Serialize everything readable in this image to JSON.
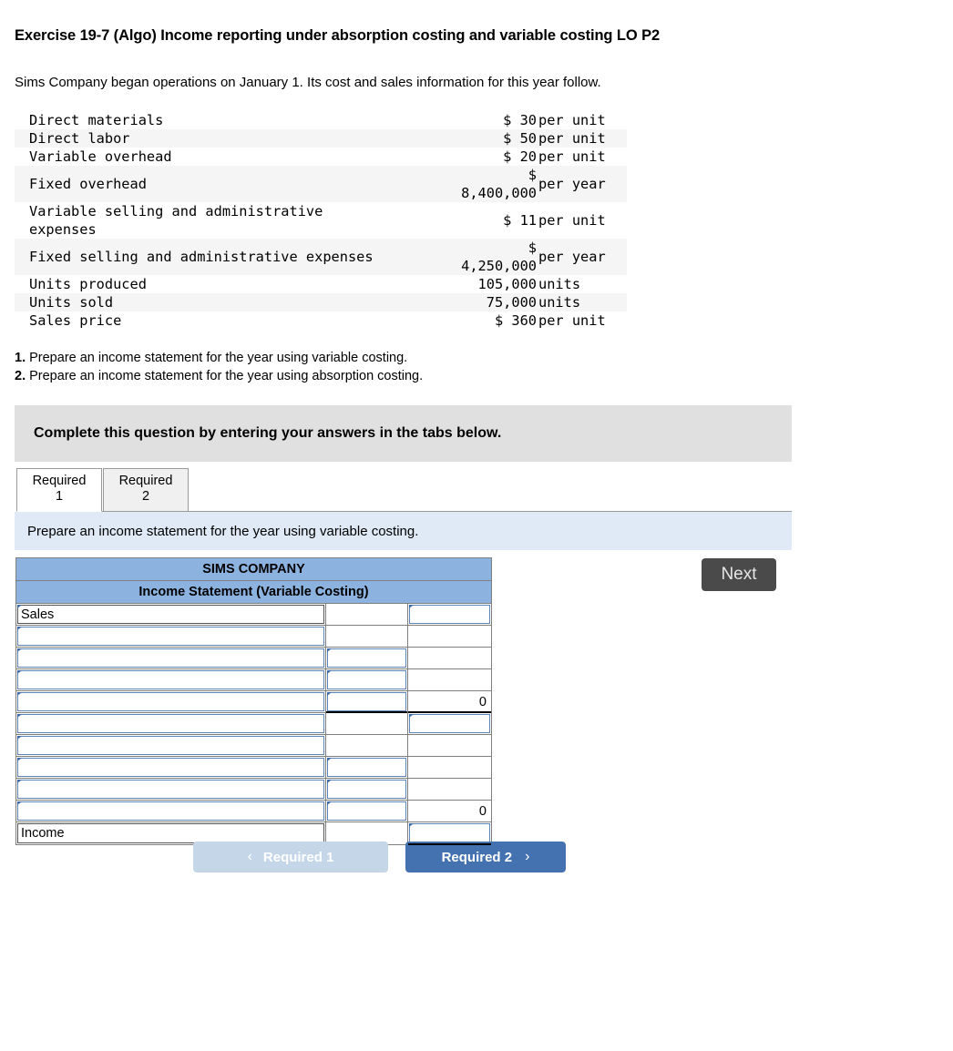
{
  "exercise": {
    "title": "Exercise 19-7 (Algo) Income reporting under absorption costing and variable costing LO P2",
    "intro": "Sims Company began operations on January 1. Its cost and sales information for this year follow."
  },
  "fact_table": {
    "rows": [
      {
        "label": "Direct materials",
        "amount": "$ 30",
        "unit": "per unit",
        "tall": false
      },
      {
        "label": "Direct labor",
        "amount": "$ 50",
        "unit": "per unit",
        "tall": false
      },
      {
        "label": "Variable overhead",
        "amount": "$ 20",
        "unit": "per unit",
        "tall": false
      },
      {
        "label": "Fixed overhead",
        "amount": "$\n8,400,000",
        "unit": "per year",
        "tall": true
      },
      {
        "label": "Variable selling and administrative\nexpenses",
        "amount": "$ 11",
        "unit": "per unit",
        "tall": true
      },
      {
        "label": "Fixed selling and administrative expenses",
        "amount": "$\n4,250,000",
        "unit": "per year",
        "tall": true
      },
      {
        "label": "Units produced",
        "amount": "105,000",
        "unit": "units",
        "tall": false
      },
      {
        "label": "Units sold",
        "amount": "75,000",
        "unit": "units",
        "tall": false
      },
      {
        "label": "Sales price",
        "amount": "$ 360",
        "unit": "per unit",
        "tall": false
      }
    ]
  },
  "requirements": [
    {
      "num": "1.",
      "text": " Prepare an income statement for the year using variable costing."
    },
    {
      "num": "2.",
      "text": " Prepare an income statement for the year using absorption costing."
    }
  ],
  "complete_bar": {
    "text": "Complete this question by entering your answers in the tabs below."
  },
  "tabs": [
    {
      "line1": "Required",
      "line2": "1",
      "active": true
    },
    {
      "line1": "Required",
      "line2": "2",
      "active": false
    }
  ],
  "instruction": {
    "text": "Prepare an income statement for the year using variable costing."
  },
  "worksheet": {
    "title_line1": "SIMS COMPANY",
    "title_line2": "Income Statement (Variable Costing)",
    "rows": [
      {
        "desc": "Sales",
        "desc_border": "dark",
        "desc_marker": true,
        "mid": "",
        "mid_border": "none",
        "mid_marker": false,
        "amt": "",
        "amt_border": "blue",
        "amt_marker": true,
        "amt_rule": false,
        "mid_rule": false
      },
      {
        "desc": "",
        "desc_border": "blue",
        "desc_marker": true,
        "mid": "",
        "mid_border": "none",
        "mid_marker": false,
        "amt": "",
        "amt_border": "none",
        "amt_marker": false,
        "amt_rule": false,
        "mid_rule": false
      },
      {
        "desc": "",
        "desc_border": "blue",
        "desc_marker": true,
        "mid": "",
        "mid_border": "blue",
        "mid_marker": true,
        "amt": "",
        "amt_border": "none",
        "amt_marker": false,
        "amt_rule": false,
        "mid_rule": false
      },
      {
        "desc": "",
        "desc_border": "blue",
        "desc_marker": true,
        "mid": "",
        "mid_border": "blue",
        "mid_marker": true,
        "amt": "",
        "amt_border": "none",
        "amt_marker": false,
        "amt_rule": false,
        "mid_rule": false
      },
      {
        "desc": "",
        "desc_border": "blue",
        "desc_marker": true,
        "mid": "",
        "mid_border": "blue",
        "mid_marker": true,
        "amt": "0",
        "amt_border": "none",
        "amt_marker": false,
        "amt_rule": true,
        "mid_rule": true
      },
      {
        "desc": "",
        "desc_border": "blue",
        "desc_marker": true,
        "mid": "",
        "mid_border": "none",
        "mid_marker": false,
        "amt": "",
        "amt_border": "blue",
        "amt_marker": true,
        "amt_rule": false,
        "mid_rule": false
      },
      {
        "desc": "",
        "desc_border": "blue",
        "desc_marker": true,
        "mid": "",
        "mid_border": "none",
        "mid_marker": false,
        "amt": "",
        "amt_border": "none",
        "amt_marker": false,
        "amt_rule": false,
        "mid_rule": false
      },
      {
        "desc": "",
        "desc_border": "blue",
        "desc_marker": true,
        "mid": "",
        "mid_border": "blue",
        "mid_marker": true,
        "amt": "",
        "amt_border": "none",
        "amt_marker": false,
        "amt_rule": false,
        "mid_rule": false
      },
      {
        "desc": "",
        "desc_border": "blue",
        "desc_marker": true,
        "mid": "",
        "mid_border": "blue",
        "mid_marker": true,
        "amt": "",
        "amt_border": "none",
        "amt_marker": false,
        "amt_rule": false,
        "mid_rule": false
      },
      {
        "desc": "",
        "desc_border": "blue",
        "desc_marker": true,
        "mid": "",
        "mid_border": "blue",
        "mid_marker": true,
        "amt": "0",
        "amt_border": "none",
        "amt_marker": false,
        "amt_rule": false,
        "mid_rule": false
      },
      {
        "desc": "Income",
        "desc_border": "dark",
        "desc_marker": false,
        "mid": "",
        "mid_border": "none",
        "mid_marker": false,
        "amt": "",
        "amt_border": "blue",
        "amt_marker": true,
        "amt_rule": true,
        "mid_rule": false
      }
    ]
  },
  "nav": {
    "prev_label": "Required 1",
    "prev_chevron": "chevron-left-icon",
    "next_label": "Required 2",
    "next_chevron": "chevron-right-icon",
    "prev_glyph": "‹",
    "next_glyph": "›"
  },
  "next_button": {
    "label": "Next"
  },
  "colors": {
    "header_blue": "#8cb2e0",
    "instruction_blue": "#dfeaf6",
    "complete_gray": "#e0e0e0",
    "nav_next_blue": "#4472b0",
    "nav_prev_blue": "#c6d6e9",
    "next_dark": "#4a4a4a",
    "cell_blue_border": "#5b84b8"
  }
}
